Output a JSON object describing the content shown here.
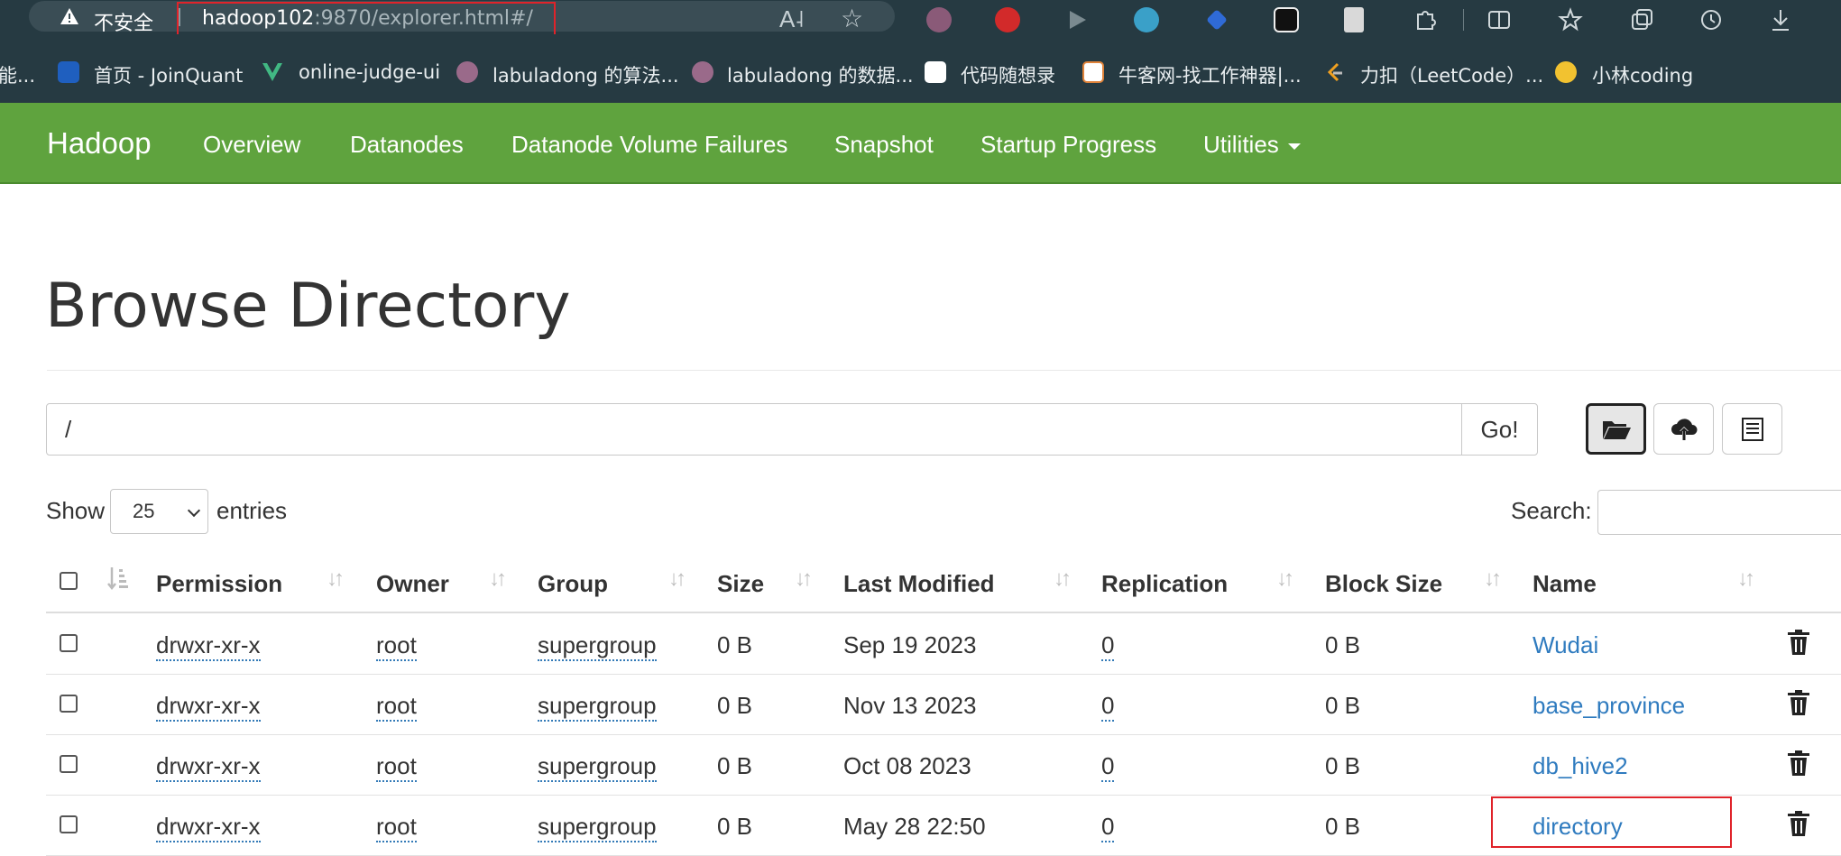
{
  "browser": {
    "insecure_label": "不安全",
    "url_host": "hadoop102",
    "url_rest": ":9870/explorer.html#/",
    "bookmarks": [
      {
        "label": "能...",
        "icon": "bookmark-icon"
      },
      {
        "label": "首页 - JoinQuant",
        "icon": "joinquant-icon"
      },
      {
        "label": "online-judge-ui",
        "icon": "vue-icon"
      },
      {
        "label": "labuladong 的算法...",
        "icon": "labuladong-icon"
      },
      {
        "label": "labuladong 的数据...",
        "icon": "labuladong-icon"
      },
      {
        "label": "代码随想录",
        "icon": "dmsxl-icon"
      },
      {
        "label": "牛客网-找工作神器|...",
        "icon": "nowcoder-icon"
      },
      {
        "label": "力扣（LeetCode）...",
        "icon": "leetcode-icon"
      },
      {
        "label": "小林coding",
        "icon": "xiaolin-icon"
      }
    ]
  },
  "navbar": {
    "brand": "Hadoop",
    "items": [
      "Overview",
      "Datanodes",
      "Datanode Volume Failures",
      "Snapshot",
      "Startup Progress",
      "Utilities"
    ]
  },
  "page": {
    "title": "Browse Directory",
    "path_value": "/",
    "go_label": "Go!",
    "show_label": "Show",
    "entries_per_page": "25",
    "entries_label": "entries",
    "search_label": "Search:"
  },
  "table": {
    "columns": [
      "Permission",
      "Owner",
      "Group",
      "Size",
      "Last Modified",
      "Replication",
      "Block Size",
      "Name"
    ],
    "rows": [
      {
        "permission": "drwxr-xr-x",
        "owner": "root",
        "group": "supergroup",
        "size": "0 B",
        "modified": "Sep 19 2023",
        "replication": "0",
        "block_size": "0 B",
        "name": "Wudai"
      },
      {
        "permission": "drwxr-xr-x",
        "owner": "root",
        "group": "supergroup",
        "size": "0 B",
        "modified": "Nov 13 2023",
        "replication": "0",
        "block_size": "0 B",
        "name": "base_province"
      },
      {
        "permission": "drwxr-xr-x",
        "owner": "root",
        "group": "supergroup",
        "size": "0 B",
        "modified": "Oct 08 2023",
        "replication": "0",
        "block_size": "0 B",
        "name": "db_hive2"
      },
      {
        "permission": "drwxr-xr-x",
        "owner": "root",
        "group": "supergroup",
        "size": "0 B",
        "modified": "May 28 22:50",
        "replication": "0",
        "block_size": "0 B",
        "name": "directory"
      }
    ]
  },
  "colors": {
    "navbar": "#5fa33e",
    "link": "#2f7bbf",
    "highlight": "#e0232a",
    "browser_chrome": "#263a42"
  }
}
